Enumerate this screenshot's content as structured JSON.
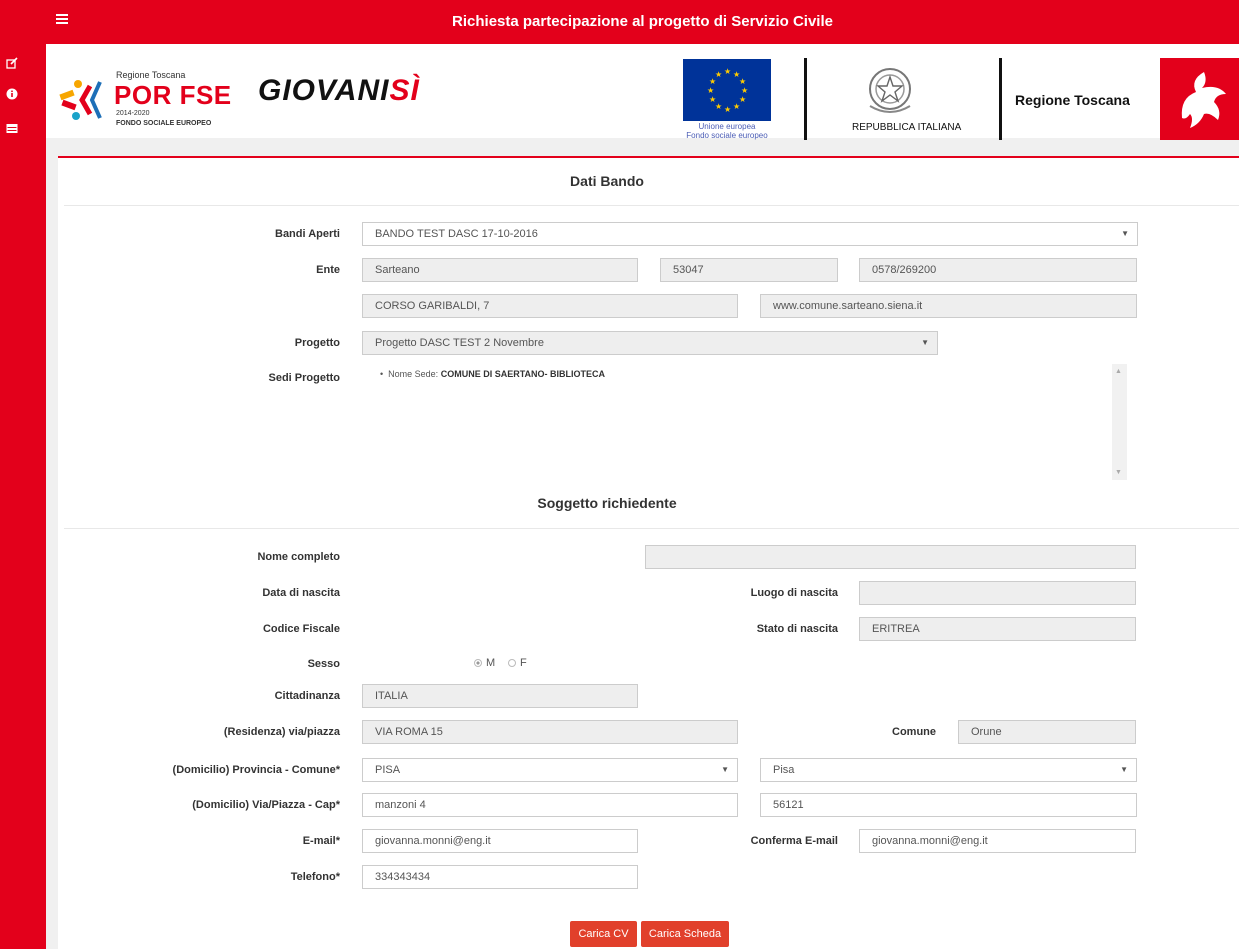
{
  "topbar": {
    "title": "Richiesta partecipazione al progetto di Servizio Civile"
  },
  "sidebar": {
    "icons": [
      "edit-icon",
      "info-icon",
      "list-icon"
    ]
  },
  "header": {
    "por": {
      "region": "Regione Toscana",
      "name": "POR FSE",
      "years": "2014-2020",
      "fund": "FONDO SOCIALE EUROPEO"
    },
    "giovani": {
      "main": "GIOVANI",
      "si": "SÌ"
    },
    "eu": {
      "line1": "Unione europea",
      "line2": "Fondo sociale europeo"
    },
    "repubblica": "REPUBBLICA ITALIANA",
    "regione": "Regione Toscana"
  },
  "bando": {
    "title": "Dati Bando",
    "labels": {
      "bandi": "Bandi Aperti",
      "ente": "Ente",
      "progetto": "Progetto",
      "sedi": "Sedi Progetto"
    },
    "bandi_value": "BANDO TEST DASC 17-10-2016",
    "ente": {
      "nome": "Sarteano",
      "cap": "53047",
      "telefono": "0578/269200",
      "indirizzo": "CORSO GARIBALDI, 7",
      "sito": "www.comune.sarteano.siena.it"
    },
    "progetto_value": "Progetto DASC TEST 2 Novembre",
    "sede": {
      "prefix": "Nome Sede:",
      "name": "COMUNE DI SAERTANO- BIBLIOTECA"
    }
  },
  "soggetto": {
    "title": "Soggetto richiedente",
    "labels": {
      "nome": "Nome completo",
      "data_nascita": "Data di nascita",
      "luogo_nascita": "Luogo di nascita",
      "cf": "Codice Fiscale",
      "stato_nascita": "Stato di nascita",
      "sesso": "Sesso",
      "cittadinanza": "Cittadinanza",
      "residenza": "(Residenza) via/piazza",
      "comune": "Comune",
      "dom_prov": "(Domicilio) Provincia - Comune*",
      "dom_via": "(Domicilio) Via/Piazza - Cap*",
      "email": "E-mail*",
      "conferma_email": "Conferma E-mail",
      "telefono": "Telefono*"
    },
    "values": {
      "nome": "",
      "luogo_nascita": "",
      "stato_nascita": "ERITREA",
      "sesso_m": "M",
      "sesso_f": "F",
      "cittadinanza": "ITALIA",
      "residenza": "VIA ROMA 15",
      "comune": "Orune",
      "dom_provincia": "PISA",
      "dom_comune": "Pisa",
      "dom_via": "manzoni 4",
      "dom_cap": "56121",
      "email": "giovanna.monni@eng.it",
      "conferma_email": "giovanna.monni@eng.it",
      "telefono": "334343434"
    }
  },
  "buttons": {
    "cv": "Carica CV",
    "scheda": "Carica Scheda"
  }
}
